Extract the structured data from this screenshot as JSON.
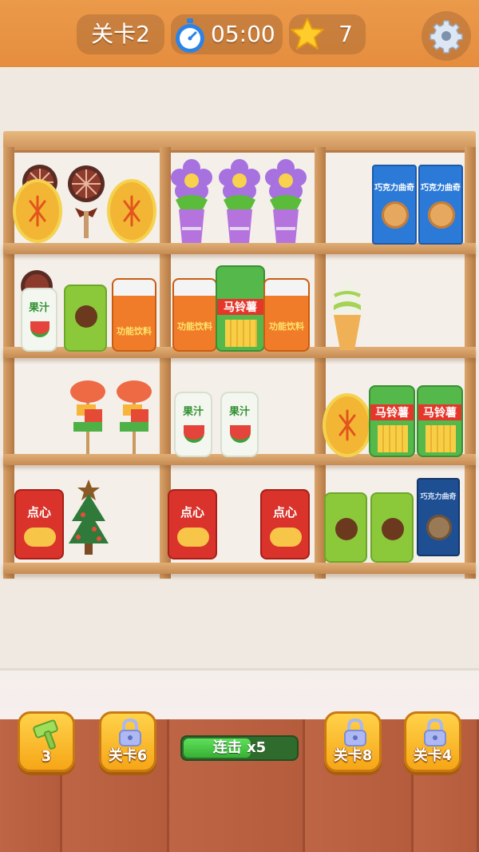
{
  "hud": {
    "level_label": "关卡2",
    "timer": "05:00",
    "stars": "7",
    "icons": [
      "stopwatch-icon",
      "star-icon",
      "gear-icon"
    ]
  },
  "shelf_items": {
    "cookie_box_label": "巧克力曲奇",
    "juice_label": "果汁",
    "sports_drink_label": "功能饮料",
    "fries_label": "马铃薯",
    "snack_label": "点心"
  },
  "bottom_bar": {
    "hammer_count": "3",
    "locked_left": "关卡6",
    "combo_label": "连击 x5",
    "combo_progress": 0.6,
    "locked_right_1": "关卡8",
    "locked_right_2": "关卡4"
  },
  "colors": {
    "topbar": "#e8953f",
    "button": "#f6a617",
    "combo_fill": "#4ccb48",
    "floor": "#b8603f"
  }
}
